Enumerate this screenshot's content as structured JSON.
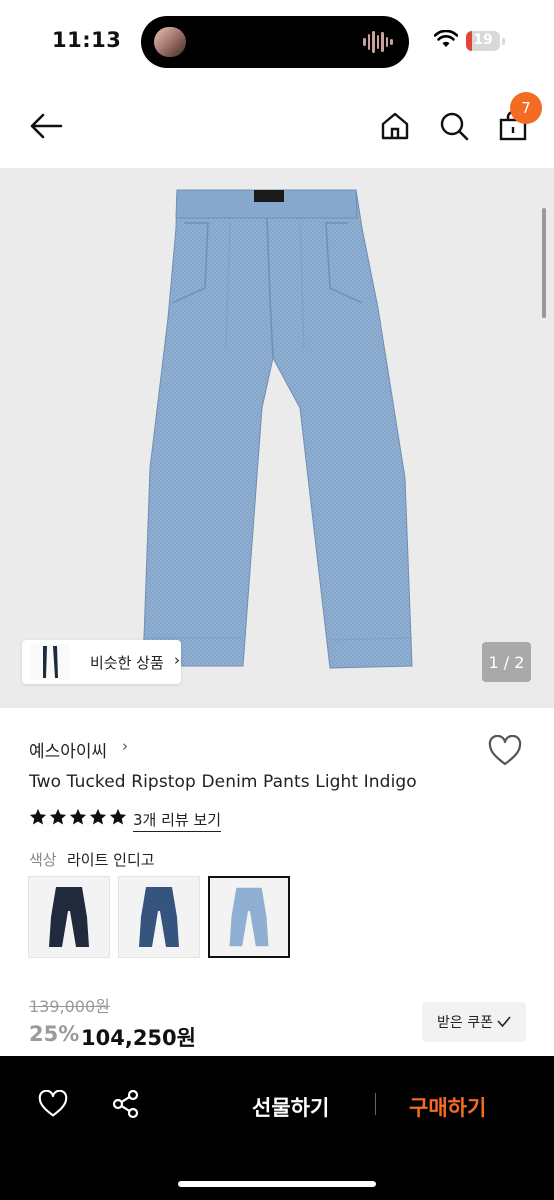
{
  "status_bar": {
    "time": "11:13",
    "battery": "19",
    "battery_level": 0.19
  },
  "header": {
    "cart_count": "7"
  },
  "gallery": {
    "similar_label": "비슷한 상품",
    "pager": "1 / 2"
  },
  "product": {
    "brand": "예스아이씨",
    "title": "Two Tucked Ripstop Denim Pants Light Indigo",
    "rating": 5,
    "review_link": "3개 리뷰 보기",
    "color_label": "색상",
    "color_value": "라이트 인디고",
    "swatches": [
      {
        "color": "#1f2a3d"
      },
      {
        "color": "#35557f"
      },
      {
        "color": "#8fb0d2"
      }
    ],
    "selected_swatch": 2,
    "original_price": "139,000원",
    "discount": "25%",
    "price": "104,250원",
    "coupon_label": "받은 쿠폰"
  },
  "bottom_bar": {
    "gift_label": "선물하기",
    "buy_label": "구매하기"
  },
  "colors": {
    "accent": "#f36c21",
    "denim": "#8fb0d2"
  }
}
